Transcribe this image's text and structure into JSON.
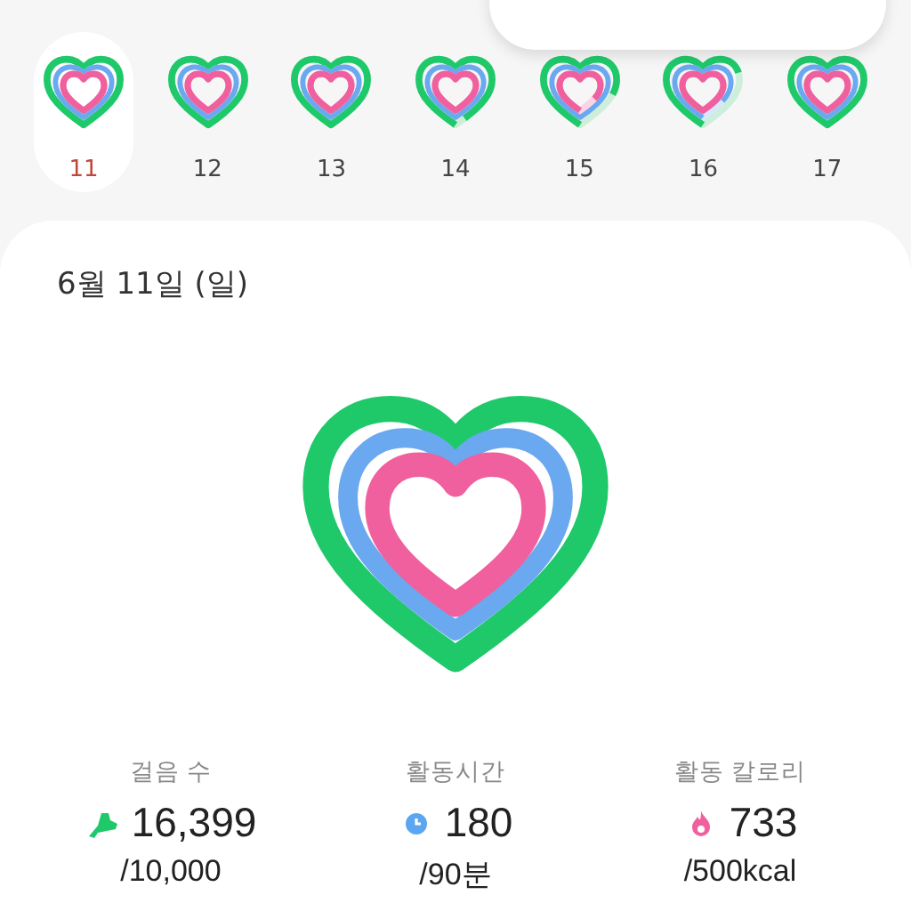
{
  "week": [
    {
      "day": "11",
      "selected": true
    },
    {
      "day": "12",
      "selected": false
    },
    {
      "day": "13",
      "selected": false
    },
    {
      "day": "14",
      "selected": false
    },
    {
      "day": "15",
      "selected": false
    },
    {
      "day": "16",
      "selected": false
    },
    {
      "day": "17",
      "selected": false
    }
  ],
  "summary": {
    "date": "6월 11일 (일)",
    "stats": [
      {
        "kind": "steps",
        "label": "걸음 수",
        "value": "16,399",
        "goal": "/10,000"
      },
      {
        "kind": "time",
        "label": "활동시간",
        "value": "180",
        "goal": "/90분"
      },
      {
        "kind": "calories",
        "label": "활동 칼로리",
        "value": "733",
        "goal": "/500kcal"
      }
    ]
  }
}
